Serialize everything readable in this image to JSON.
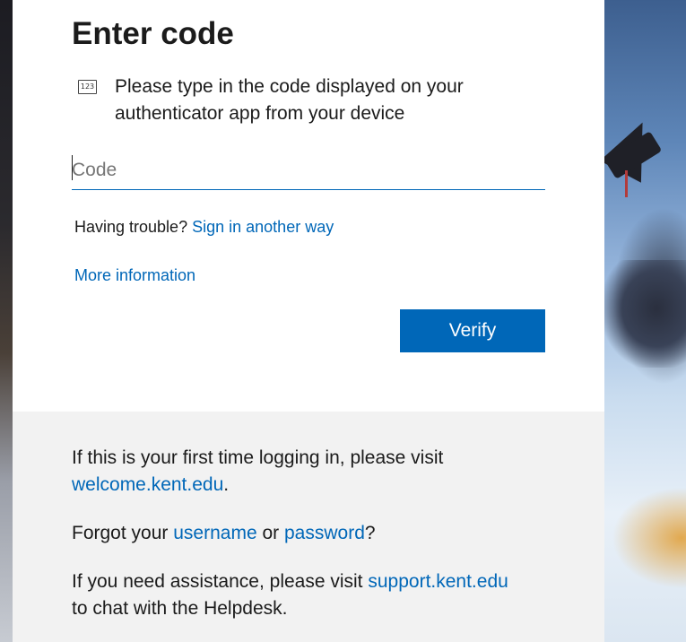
{
  "page": {
    "title": "Enter code",
    "instruction_icon": "number-pad-icon",
    "instruction_icon_text": "123",
    "instruction": "Please type in the code displayed on your authenticator app from your device"
  },
  "code_field": {
    "placeholder": "Code",
    "value": ""
  },
  "trouble": {
    "prefix": "Having trouble?",
    "link": "Sign in another way"
  },
  "more_info_link": "More information",
  "verify_button": "Verify",
  "footer": {
    "first_time_text": "If this is your first time logging in, please visit",
    "welcome_link": "welcome.kent.edu",
    "welcome_suffix": ".",
    "forgot_prefix": "Forgot your",
    "username_link": "username",
    "forgot_or": "or",
    "password_link": "password",
    "forgot_suffix": "?",
    "assist_prefix": "If you need assistance, please visit",
    "support_link": "support.kent.edu",
    "assist_suffix": "to chat with the Helpdesk."
  },
  "colors": {
    "accent": "#0067b8",
    "text": "#1b1b1b",
    "footer_bg": "#f2f2f2"
  }
}
